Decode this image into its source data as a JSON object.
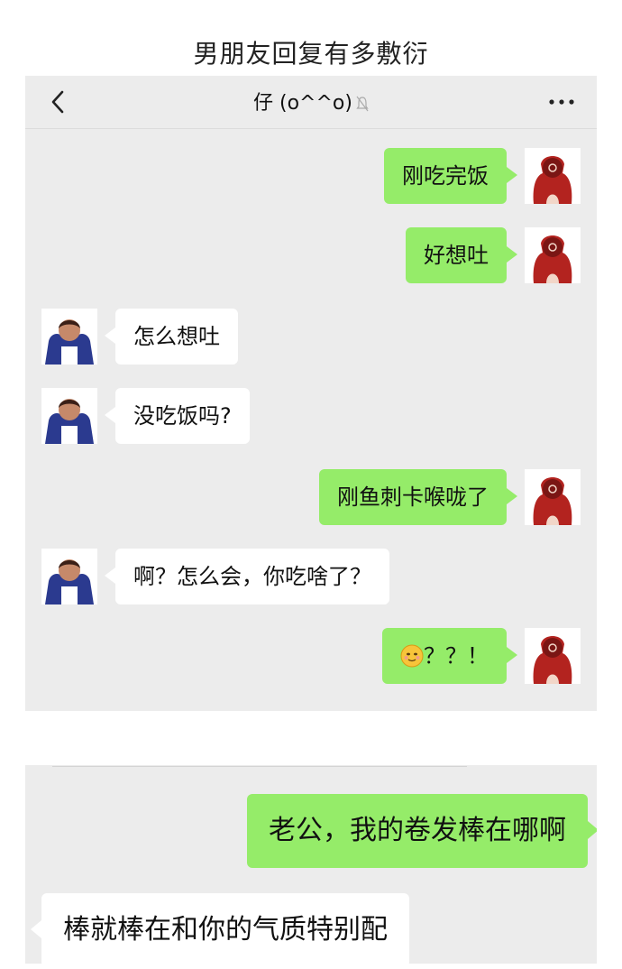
{
  "header": {
    "title": "男朋友回复有多敷衍"
  },
  "chat1": {
    "nav": {
      "title": "仔 (o^^o)",
      "back_icon": "chevron-left-icon",
      "mute_icon": "mute-bell-icon",
      "more_icon": "more-dots-icon"
    },
    "messages": [
      {
        "sender": "me",
        "text": "刚吃完饭"
      },
      {
        "sender": "me",
        "text": "好想吐"
      },
      {
        "sender": "friend",
        "text": "怎么想吐"
      },
      {
        "sender": "friend",
        "text": "没吃饭吗?"
      },
      {
        "sender": "me",
        "text": "刚鱼刺卡喉咙了"
      },
      {
        "sender": "friend",
        "text": "啊？怎么会，你吃啥了？"
      },
      {
        "sender": "me",
        "text": "？？！",
        "emoji": "smile-emoji-icon"
      }
    ]
  },
  "chat2": {
    "messages": [
      {
        "sender": "me",
        "text": "老公，我的卷发棒在哪啊"
      },
      {
        "sender": "friend",
        "text": "棒就棒在和你的气质特别配"
      }
    ]
  },
  "colors": {
    "chat_bg": "#ececec",
    "my_bubble": "#95ec69",
    "friend_bubble": "#ffffff"
  }
}
